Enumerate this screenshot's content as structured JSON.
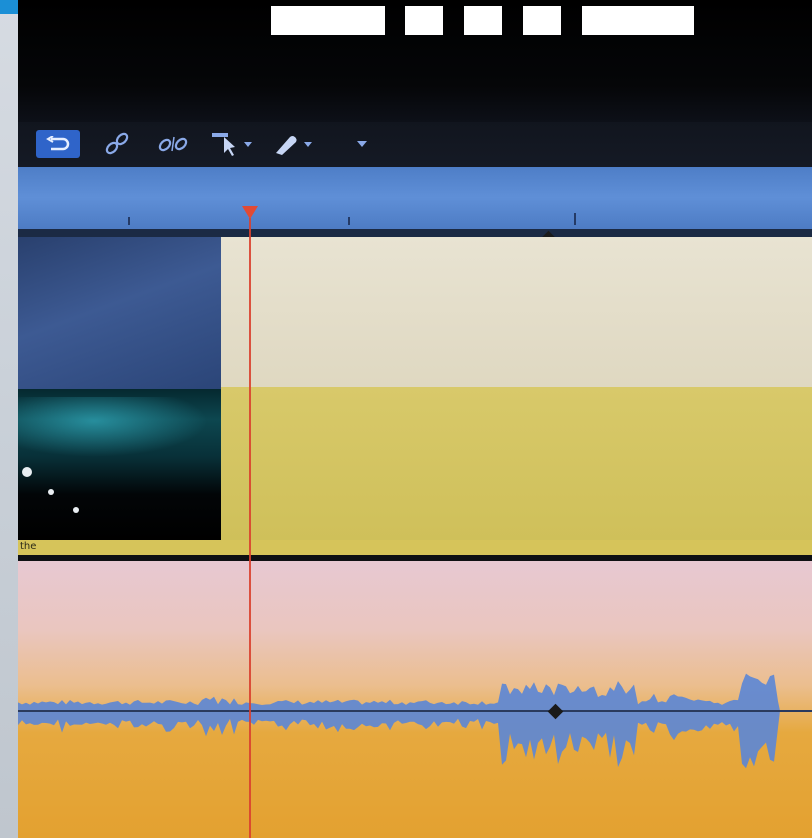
{
  "toolbar": {
    "buttons": [
      {
        "icon": "undo-icon",
        "active": true
      },
      {
        "icon": "link-icon",
        "active": false
      },
      {
        "icon": "unlink-icon",
        "active": false
      },
      {
        "icon": "select-tool-icon",
        "active": false,
        "has_dropdown": true
      },
      {
        "icon": "razor-tool-icon",
        "active": false,
        "has_dropdown": true
      },
      {
        "icon": "more-dropdown-icon",
        "active": false
      }
    ]
  },
  "timeline": {
    "playhead_color": "#e24a33",
    "video_track": {
      "clip_label": "the",
      "colors": {
        "upper": "#e8e3d2",
        "lower": "#d8c96a",
        "label_bar": "#d6c45a"
      }
    },
    "audio_track": {
      "colors": {
        "top": "#e7c8d2",
        "bottom": "#e3a130",
        "waveform": "#5b86d6"
      }
    },
    "ruler_color": "#5f8fd7"
  }
}
